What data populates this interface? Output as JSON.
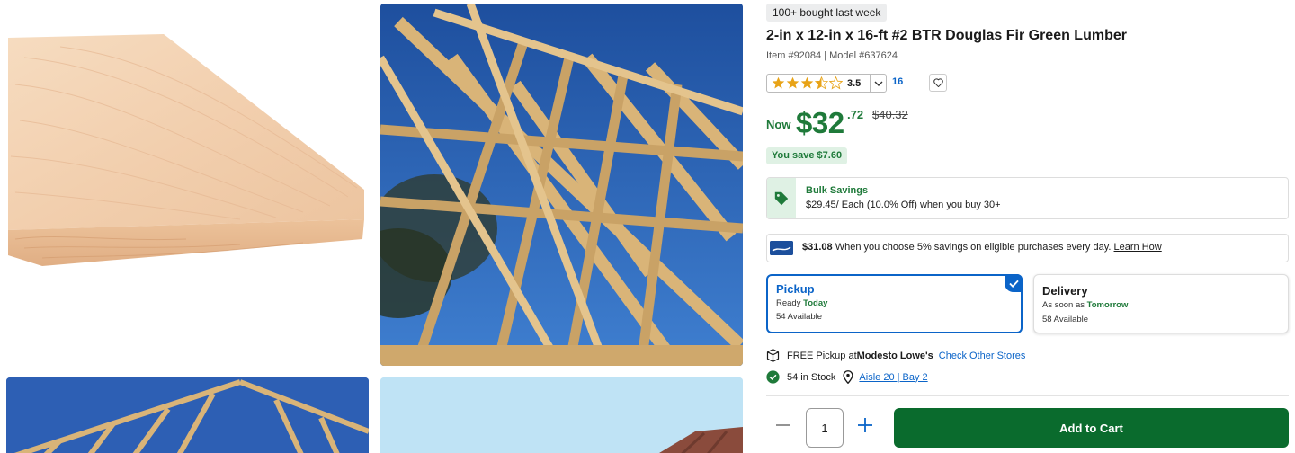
{
  "gallery": {
    "images": [
      "board-photo",
      "roof-truss-photo",
      "roof-truss-photo-2",
      "sky-photo"
    ]
  },
  "product": {
    "bought_badge": "100+ bought last week",
    "title": "2-in x 12-in x 16-ft #2 BTR Douglas Fir Green Lumber",
    "item_meta": "Item #92084 | Model #637624",
    "rating": {
      "value": "3.5",
      "stars_filled": 3.5,
      "stars_max": 5,
      "review_count": "16"
    }
  },
  "price": {
    "now_label": "Now",
    "dollars": "$32",
    "cents": ".72",
    "was": "$40.32",
    "save": "You save $7.60"
  },
  "bulk": {
    "title": "Bulk Savings",
    "desc": "$29.45/ Each (10.0% Off) when you buy 30+"
  },
  "card_offer": {
    "amount": "$31.08",
    "text": " When you choose 5% savings on eligible purchases every day. ",
    "link": "Learn How"
  },
  "fulfillment": {
    "pickup": {
      "title": "Pickup",
      "line1_prefix": "Ready ",
      "line1_highlight": "Today",
      "line2": "54 Available",
      "selected": true
    },
    "delivery": {
      "title": "Delivery",
      "line1_prefix": "As soon as ",
      "line1_highlight": "Tomorrow",
      "line2": "58 Available"
    }
  },
  "store": {
    "pickup_prefix": "FREE Pickup at ",
    "store_name": "Modesto Lowe's",
    "check_link": "Check Other Stores",
    "stock": "54 in Stock",
    "aisle": "Aisle 20 | Bay 2"
  },
  "cart": {
    "quantity": "1",
    "add_label": "Add to Cart"
  },
  "colors": {
    "accent_green": "#1f7a3a",
    "button_green": "#0a6b2d",
    "link_blue": "#0b64c8",
    "star_gold": "#e8a317"
  }
}
